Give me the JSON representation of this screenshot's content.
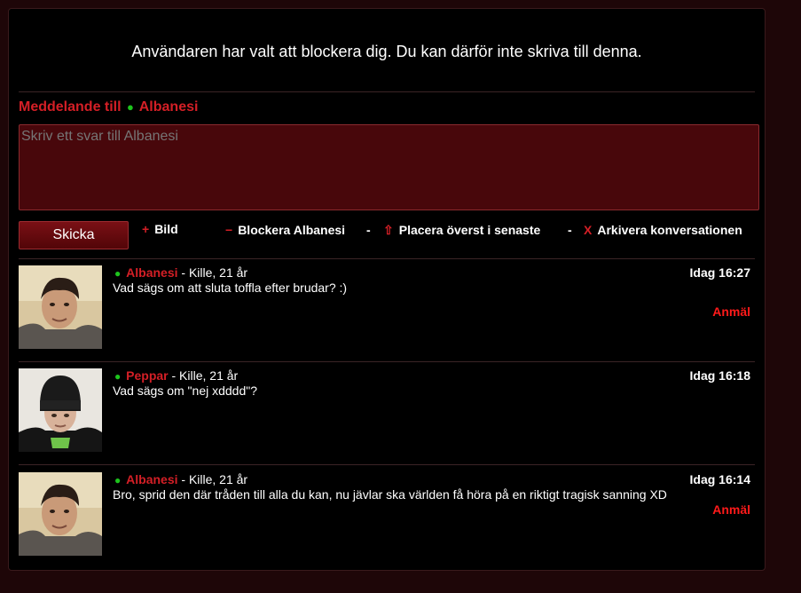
{
  "notice": "Användaren har valt att blockera dig. Du kan därför inte skriva till denna.",
  "compose": {
    "heading_prefix": "Meddelande till",
    "recipient": "Albanesi",
    "placeholder": "Skriv ett svar till Albanesi",
    "send_label": "Skicka"
  },
  "actions": {
    "image_icon": "+",
    "image_label": "Bild",
    "block_icon": "−",
    "block_label": "Blockera Albanesi",
    "pin_icon": "⇧",
    "pin_label": "Placera överst i senaste",
    "archive_icon": "X",
    "archive_label": "Arkivera konversationen",
    "separator": "-"
  },
  "messages": [
    {
      "name": "Albanesi",
      "info": "- Kille, 21 år",
      "time": "Idag 16:27",
      "text": "Vad sägs om att sluta toffla efter brudar? :)",
      "report": "Anmäl"
    },
    {
      "name": "Peppar",
      "info": "- Kille, 21 år",
      "time": "Idag 16:18",
      "text": "Vad sägs om \"nej xdddd\"?",
      "report": ""
    },
    {
      "name": "Albanesi",
      "info": "- Kille, 21 år",
      "time": "Idag 16:14",
      "text": "Bro, sprid den där tråden till alla du kan, nu jävlar ska världen få höra på en riktigt tragisk sanning XD",
      "report": "Anmäl"
    }
  ],
  "online_dot": "●",
  "colors": {
    "accent": "#d41f26",
    "online": "#1dc41d",
    "report": "#ff1a1a",
    "input_bg": "#48070b"
  }
}
